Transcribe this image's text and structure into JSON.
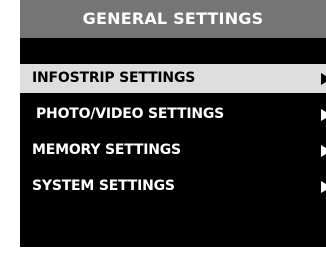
{
  "header": {
    "title": "GENERAL SETTINGS"
  },
  "menu": {
    "items": [
      {
        "label": "INFOSTRIP SETTINGS",
        "selected": true,
        "icon": "triangle-right-icon"
      },
      {
        "label": "PHOTO/VIDEO SETTINGS",
        "selected": false,
        "icon": "triangle-right-icon"
      },
      {
        "label": "MEMORY SETTINGS",
        "selected": false,
        "icon": "triangle-right-icon"
      },
      {
        "label": "SYSTEM SETTINGS",
        "selected": false,
        "icon": "triangle-right-icon"
      }
    ]
  },
  "colors": {
    "background": "#000000",
    "title_bar": "#757575",
    "selected_row": "#dedede",
    "text": "#ffffff",
    "selected_text": "#000000"
  }
}
